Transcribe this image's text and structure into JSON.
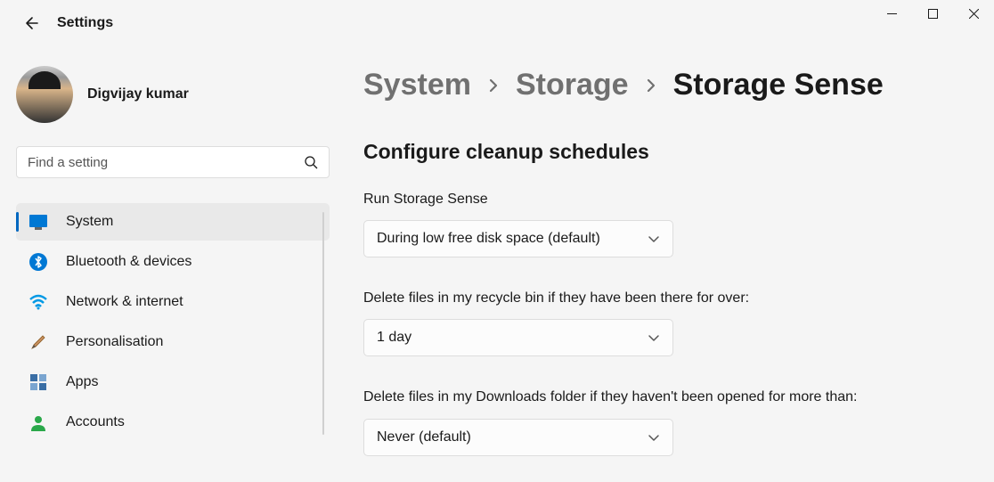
{
  "titlebar": {
    "minimize": "−",
    "maximize": "□",
    "close": "×"
  },
  "header": {
    "title": "Settings"
  },
  "profile": {
    "name": "Digvijay kumar"
  },
  "search": {
    "placeholder": "Find a setting"
  },
  "nav": {
    "items": [
      {
        "label": "System",
        "icon": "system-icon"
      },
      {
        "label": "Bluetooth & devices",
        "icon": "bluetooth-icon"
      },
      {
        "label": "Network & internet",
        "icon": "wifi-icon"
      },
      {
        "label": "Personalisation",
        "icon": "brush-icon"
      },
      {
        "label": "Apps",
        "icon": "apps-icon"
      },
      {
        "label": "Accounts",
        "icon": "accounts-icon"
      }
    ]
  },
  "breadcrumb": {
    "root": "System",
    "parent": "Storage",
    "current": "Storage Sense"
  },
  "section": {
    "title": "Configure cleanup schedules"
  },
  "settings": {
    "run_label": "Run Storage Sense",
    "run_value": "During low free disk space (default)",
    "recycle_label": "Delete files in my recycle bin if they have been there for over:",
    "recycle_value": "1 day",
    "downloads_label": "Delete files in my Downloads folder if they haven't been opened for more than:",
    "downloads_value": "Never (default)"
  }
}
